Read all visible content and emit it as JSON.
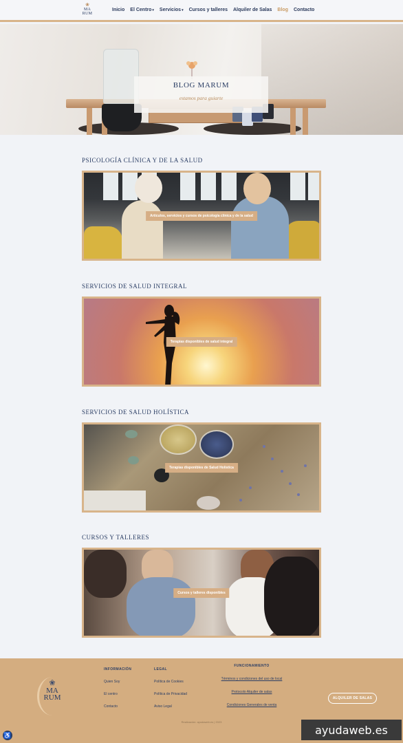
{
  "header": {
    "logo": {
      "line1": "MA",
      "line2": "RUM"
    },
    "nav": [
      {
        "label": "Inicio",
        "dropdown": false,
        "active": false
      },
      {
        "label": "El Centro",
        "dropdown": true,
        "active": false
      },
      {
        "label": "Servicios",
        "dropdown": true,
        "active": false
      },
      {
        "label": "Cursos y talleres",
        "dropdown": false,
        "active": false
      },
      {
        "label": "Alquiler de Salas",
        "dropdown": false,
        "active": false
      },
      {
        "label": "Blog",
        "dropdown": false,
        "active": true
      },
      {
        "label": "Contacto",
        "dropdown": false,
        "active": false
      }
    ]
  },
  "hero": {
    "title": "BLOG MARUM",
    "subtitle": "estamos para guiarte"
  },
  "sections": [
    {
      "title": "PSICOLOGÍA CLÍNICA Y DE LA SALUD",
      "caption": "Artículos, servicios y cursos de psicología clínica y de la salud"
    },
    {
      "title": "SERVICIOS DE SALUD INTEGRAL",
      "caption": "Terapias disponibles de salud integral"
    },
    {
      "title": "SERVICIOS DE SALUD HOLÍSTICA",
      "caption": "Terapias disponibles de Salud Holística"
    },
    {
      "title": "CURSOS Y TALLERES",
      "caption": "Cursos y talleres disponibles"
    }
  ],
  "footer": {
    "logo": {
      "line1": "MA",
      "line2": "RUM"
    },
    "informacion": {
      "heading": "INFORMACIÓN",
      "links": [
        "Quien Soy",
        "El centro",
        "Contacto"
      ]
    },
    "legal": {
      "heading": "LEGAL",
      "links": [
        "Política de Cookies",
        "Política de Privacidad",
        "Aviso Legal"
      ]
    },
    "funcionamiento": {
      "heading": "FUNCIONAMIENTO",
      "links": [
        "Términos y condiciones del uso de local",
        "Protocolo Alquiler de salas",
        "Condiciones Generales de venta"
      ]
    },
    "cta": "ALQUILER DE SALAS",
    "credit": "Realización: ayudaweb.es | 2023"
  },
  "watermark": "ayudaweb.es",
  "colors": {
    "accent": "#d8b48a",
    "navy": "#2a3d64",
    "footer_bg": "#d4ad80",
    "active_nav": "#c99b63"
  },
  "icons": {
    "accessibility": "accessibility-icon",
    "logo_flower": "lotus-icon"
  }
}
